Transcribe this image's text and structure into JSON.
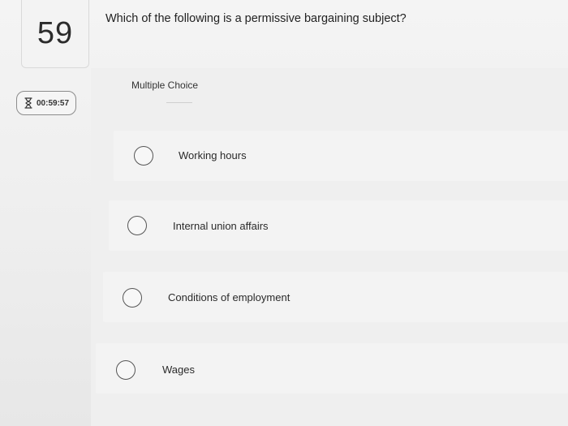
{
  "question_number": "59",
  "timer": {
    "icon": "hourglass-icon",
    "value": "00:59:57"
  },
  "question": {
    "text": "Which of the following is a permissive bargaining subject?"
  },
  "answer_type": "Multiple Choice",
  "options": [
    {
      "label": "Working hours",
      "selected": false
    },
    {
      "label": "Internal union affairs",
      "selected": false
    },
    {
      "label": "Conditions of employment",
      "selected": false
    },
    {
      "label": "Wages",
      "selected": false
    }
  ]
}
